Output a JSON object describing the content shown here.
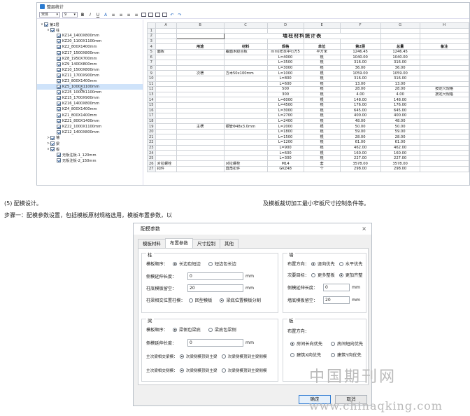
{
  "app": {
    "title": "整层统计",
    "font_name": "宋体",
    "font_size": "9",
    "tb_bold": "B",
    "tb_italic": "I",
    "tb_under": "U"
  },
  "tree": [
    {
      "label": "第2层",
      "depth": 0,
      "arrow": "∨"
    },
    {
      "label": "柱",
      "depth": 1,
      "arrow": "∨"
    },
    {
      "label": "KZ14_1400X800mm",
      "depth": 2
    },
    {
      "label": "KZ20_1100X1100mm",
      "depth": 2
    },
    {
      "label": "KZ2_800X1400mm",
      "depth": 2
    },
    {
      "label": "KZ17_1500X800mm",
      "depth": 2
    },
    {
      "label": "KZ8_1950X700mm",
      "depth": 2
    },
    {
      "label": "KZ9_1400X800mm",
      "depth": 2
    },
    {
      "label": "KZ10_1500X800mm",
      "depth": 2
    },
    {
      "label": "KZ11_1700X900mm",
      "depth": 2
    },
    {
      "label": "KZ3_800X1400mm",
      "depth": 2
    },
    {
      "label": "KZ5_1000X1100mm",
      "depth": 2,
      "hl": true
    },
    {
      "label": "KZ25_1000X1100mm",
      "depth": 2
    },
    {
      "label": "KZ15_1700X900mm",
      "depth": 2
    },
    {
      "label": "KZ16_1400X800mm",
      "depth": 2
    },
    {
      "label": "KZ4_800X1400mm",
      "depth": 2
    },
    {
      "label": "KZ1_800X1400mm",
      "depth": 2
    },
    {
      "label": "KZ21_800X1400mm",
      "depth": 2
    },
    {
      "label": "KZ22_1000X1100mm",
      "depth": 2
    },
    {
      "label": "KZ12_1400X800mm",
      "depth": 2
    },
    {
      "label": "墙",
      "depth": 1,
      "arrow": ">"
    },
    {
      "label": "梁",
      "depth": 1,
      "arrow": ">"
    },
    {
      "label": "板",
      "depth": 1,
      "arrow": "∨"
    },
    {
      "label": "无板注板-1_120mm",
      "depth": 2
    },
    {
      "label": "无板注板-2_150mm",
      "depth": 2
    }
  ],
  "sheet": {
    "cols": [
      "",
      "A",
      "B",
      "C",
      "D",
      "E",
      "F",
      "G",
      "H"
    ],
    "title": "墙柱材料统计表",
    "headers": [
      "用途",
      "材料",
      "规格",
      "单位",
      "第2层",
      "总量",
      "备注"
    ],
    "rows": [
      [
        "5",
        "面板",
        "",
        "覆面木胶合板",
        "mm(样本中行方5",
        "平方米",
        "1246.45",
        "1246.45",
        ""
      ],
      [
        "6",
        "",
        "",
        "",
        "L=4000",
        "根",
        "1040.00",
        "1040.00",
        ""
      ],
      [
        "7",
        "",
        "",
        "",
        "L=3500",
        "根",
        "316.00",
        "316.00",
        ""
      ],
      [
        "8",
        "",
        "",
        "",
        "L=3000",
        "根",
        "36.00",
        "36.00",
        ""
      ],
      [
        "9",
        "",
        "次楞",
        "方木50x100mm",
        "L=1000",
        "根",
        "1059.00",
        "1059.00",
        ""
      ],
      [
        "10",
        "",
        "",
        "",
        "L=800",
        "根",
        "316.00",
        "316.00",
        ""
      ],
      [
        "11",
        "",
        "",
        "",
        "L=600",
        "根",
        "13.00",
        "13.00",
        ""
      ],
      [
        "12",
        "",
        "",
        "",
        "500",
        "根",
        "28.00",
        "28.00",
        "按定尺规格"
      ],
      [
        "13",
        "",
        "",
        "",
        "300",
        "根",
        "4.00",
        "4.00",
        "按定尺规格"
      ],
      [
        "14",
        "",
        "",
        "",
        "L=6000",
        "根",
        "148.00",
        "148.00",
        ""
      ],
      [
        "15",
        "",
        "",
        "",
        "L=4500",
        "根",
        "176.00",
        "176.00",
        ""
      ],
      [
        "16",
        "",
        "",
        "",
        "L=3000",
        "根",
        "645.00",
        "645.00",
        ""
      ],
      [
        "17",
        "",
        "",
        "",
        "L=2700",
        "根",
        "400.00",
        "400.00",
        ""
      ],
      [
        "18",
        "",
        "",
        "",
        "L=2400",
        "根",
        "48.00",
        "48.00",
        ""
      ],
      [
        "19",
        "",
        "主楞",
        "钢管Φ48x3.0mm",
        "L=2000",
        "根",
        "50.00",
        "50.00",
        ""
      ],
      [
        "20",
        "",
        "",
        "",
        "L=1800",
        "根",
        "59.00",
        "59.00",
        ""
      ],
      [
        "21",
        "",
        "",
        "",
        "L=1500",
        "根",
        "28.00",
        "28.00",
        ""
      ],
      [
        "22",
        "",
        "",
        "",
        "L=1200",
        "根",
        "61.00",
        "61.00",
        ""
      ],
      [
        "23",
        "",
        "",
        "",
        "L=900",
        "根",
        "462.00",
        "462.00",
        ""
      ],
      [
        "24",
        "",
        "",
        "",
        "L=600",
        "根",
        "160.00",
        "160.00",
        ""
      ],
      [
        "25",
        "",
        "",
        "",
        "L=300",
        "根",
        "227.00",
        "227.00",
        ""
      ],
      [
        "26",
        "对拉螺栓",
        "",
        "对拉螺栓",
        "M14",
        "套",
        "3578.00",
        "3578.00",
        ""
      ],
      [
        "27",
        "扣件",
        "",
        "直角扣件",
        "GKZ48",
        "个",
        "298.00",
        "298.00",
        ""
      ]
    ]
  },
  "text": {
    "line1a": "(5) 配模设计。",
    "line1b": "及模板裁切加工最小窄板尺寸控制条件等。",
    "line2": "步骤一：配模参数设置，包括模板原材规格选用，模板布置参数，以"
  },
  "dialog": {
    "title": "配模参数",
    "close": "×",
    "tabs": [
      "模板材料",
      "布置参数",
      "尺寸控制",
      "其他"
    ],
    "col": {
      "title": "柱",
      "order_label": "模板顺序：",
      "order_opts": [
        "长边包短边",
        "短边包长边"
      ],
      "ext_label": "侧模延伸长度：",
      "ext_val": "0",
      "gap_label": "柱底模板留空：",
      "gap_val": "20",
      "pos_label": "柱梁相交位置柱模：",
      "pos_opts": [
        "回型模板",
        "梁底位置模板分割"
      ],
      "unit": "mm"
    },
    "wall": {
      "title": "墙",
      "dir_label": "布置方向：",
      "dir_opts": [
        "竖向优先",
        "水平优先"
      ],
      "goal_label": "次要目标：",
      "goal_opts": [
        "更多整板",
        "更加齐整"
      ],
      "ext_label": "侧模延伸长度：",
      "ext_val": "0",
      "gap_label": "墙底模板留空：",
      "gap_val": "20",
      "unit": "mm"
    },
    "beam": {
      "title": "梁",
      "order_label": "模板顺序：",
      "order_opts": [
        "梁侧包梁底",
        "梁底包梁侧"
      ],
      "ext_label": "侧模延伸长度：",
      "ext_val": "0",
      "sec_label": "主次梁相交梁模：",
      "sec_opts": [
        "次梁侧模顶到主梁",
        "次梁侧模顶到主梁侧模"
      ],
      "sec2_label": "主次梁相交侧模：",
      "sec2_opts": [
        "次梁侧模顶到主梁",
        "次梁侧模顶到主梁侧模"
      ],
      "unit": "mm"
    },
    "slab": {
      "title": "板",
      "dir_label": "布置方向：",
      "opts": [
        "房间长向优先",
        "房间短向优先",
        "建筑X向优先",
        "建筑Y向优先"
      ]
    },
    "ok": "确定",
    "cancel": "取消"
  },
  "watermark": {
    "cn": "中国期刊网",
    "url": "www.chinaqking.com"
  }
}
